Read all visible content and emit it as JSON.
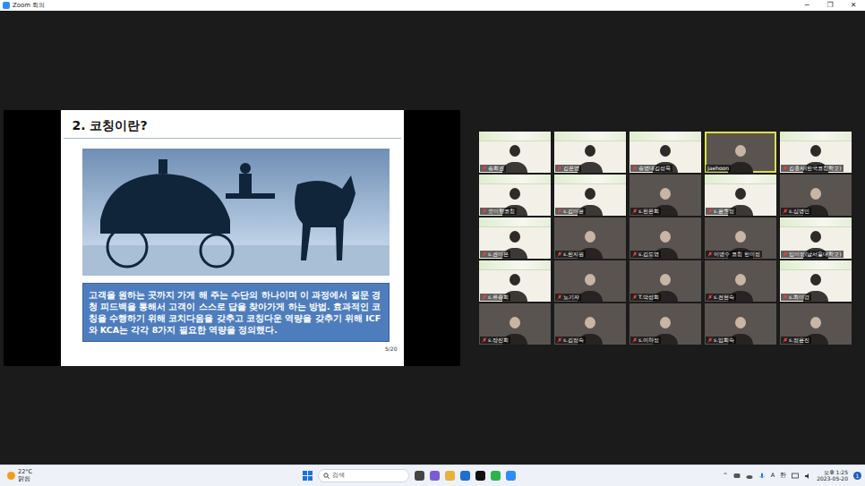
{
  "window": {
    "title": "Zoom 회의",
    "controls": [
      "−",
      "❐",
      "✕"
    ]
  },
  "slide": {
    "title": "2. 코칭이란?",
    "body": "고객을 원하는 곳까지 가게 해 주는 수단의 하나이며  이 과정에서 질문 경청 피드백을 통해서 고객이 스스로 답을 찾아가게 하는 방법. 효과적인 코칭을 수행하기 위해 코치다움을 갖추고 코칭다운 역량을 갖추기 위해 ICF와 KCA는 각각 8가지 필요한 역량을 정의했다.",
    "page": "5/20"
  },
  "gallery": {
    "tiles": [
      {
        "name": "송희권",
        "kind": "banner",
        "muted": true,
        "speaking": false
      },
      {
        "name": "김은영",
        "kind": "banner",
        "muted": true,
        "speaking": false
      },
      {
        "name": "송영대김성욱",
        "kind": "banner",
        "muted": true,
        "speaking": false
      },
      {
        "name": "Jaehoon",
        "kind": "camera",
        "muted": false,
        "speaking": true
      },
      {
        "name": "김홍자(한국코칭학교)",
        "kind": "banner",
        "muted": true,
        "speaking": false
      },
      {
        "name": "요미향코칭",
        "kind": "banner",
        "muted": true,
        "speaking": false
      },
      {
        "name": "s.김미윤",
        "kind": "banner",
        "muted": true,
        "speaking": false
      },
      {
        "name": "s.한은희",
        "kind": "camera",
        "muted": true,
        "speaking": false
      },
      {
        "name": "s.윤호정",
        "kind": "banner",
        "muted": true,
        "speaking": false
      },
      {
        "name": "s.심명민",
        "kind": "camera",
        "muted": true,
        "speaking": false
      },
      {
        "name": "s.권미은",
        "kind": "banner",
        "muted": true,
        "speaking": false
      },
      {
        "name": "s.한지원",
        "kind": "camera",
        "muted": true,
        "speaking": false
      },
      {
        "name": "s.김도영",
        "kind": "camera",
        "muted": true,
        "speaking": false
      },
      {
        "name": "이명수 코칭 한미정",
        "kind": "camera",
        "muted": true,
        "speaking": false
      },
      {
        "name": "임미정(남서울대학교)",
        "kind": "banner",
        "muted": true,
        "speaking": false
      },
      {
        "name": "s.류종희",
        "kind": "banner",
        "muted": true,
        "speaking": false
      },
      {
        "name": "노기자",
        "kind": "camera",
        "muted": true,
        "speaking": false
      },
      {
        "name": "T.박성희",
        "kind": "camera",
        "muted": true,
        "speaking": false
      },
      {
        "name": "s.전현숙",
        "kind": "camera",
        "muted": true,
        "speaking": false
      },
      {
        "name": "s.최미경",
        "kind": "banner",
        "muted": true,
        "speaking": false
      },
      {
        "name": "s.장진희",
        "kind": "camera",
        "muted": true,
        "speaking": false
      },
      {
        "name": "s.김정숙",
        "kind": "camera",
        "muted": true,
        "speaking": false
      },
      {
        "name": "s.이하정",
        "kind": "camera",
        "muted": true,
        "speaking": false
      },
      {
        "name": "s.임희숙",
        "kind": "camera",
        "muted": true,
        "speaking": false
      },
      {
        "name": "s.정윤진",
        "kind": "camera",
        "muted": true,
        "speaking": false
      }
    ]
  },
  "taskbar": {
    "weather": {
      "temp": "22°C",
      "condition": "맑음"
    },
    "search": {
      "placeholder": "검색"
    },
    "tray": {
      "arrow": "^",
      "ime": "A",
      "lang": "한"
    },
    "clock": {
      "time": "오후 1:25",
      "date": "2023-05-20"
    },
    "notifications": "1"
  }
}
